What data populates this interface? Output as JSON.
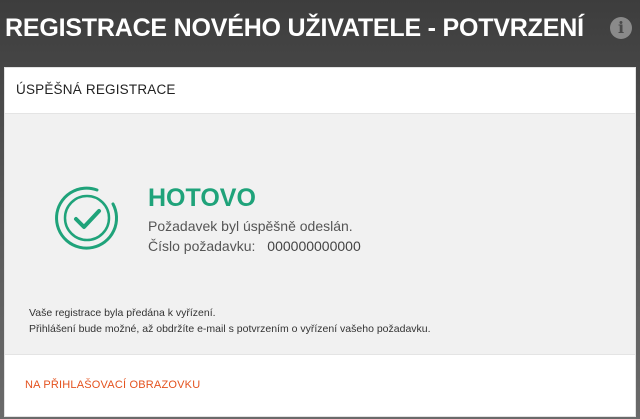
{
  "header": {
    "title": "REGISTRACE NOVÉHO UŽIVATELE - POTVRZENÍ",
    "info_icon": "info-icon",
    "info_glyph": "i"
  },
  "panel": {
    "title": "ÚSPĚŠNÁ REGISTRACE"
  },
  "status": {
    "icon": "check-circle-icon",
    "title": "HOTOVO",
    "message": "Požadavek byl úspěšně odeslán.",
    "request_label": "Číslo požadavku:",
    "request_number": "000000000000",
    "accent_color": "#1fa37a"
  },
  "notice": {
    "line1": "Vaše registrace byla předána k vyřízení.",
    "line2": "Přihlášení bude možné, až obdržíte e-mail s potvrzením o vyřízení vašeho požadavku."
  },
  "footer": {
    "link_label": "NA PŘIHLAŠOVACÍ OBRAZOVKU",
    "link_color": "#e4521e"
  }
}
